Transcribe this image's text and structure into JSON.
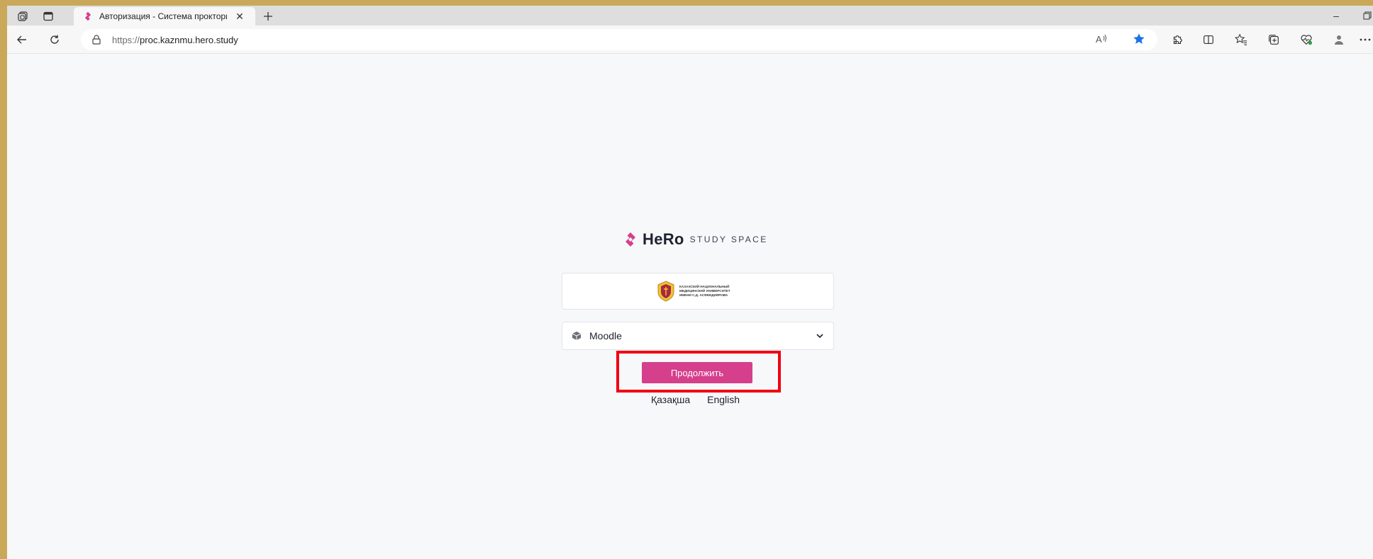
{
  "browser": {
    "tab_title": "Авторизация - Система прокторинга",
    "url_scheme": "https://",
    "url_host": "proc.kaznmu.hero.study"
  },
  "brand": {
    "name": "HeRo",
    "subtitle": "STUDY SPACE",
    "accent_color": "#d63f8c"
  },
  "university": {
    "name": "КАЗАХСКИЙ НАЦИОНАЛЬНЫЙ МЕДИЦИНСКИЙ УНИВЕРСИТЕТ ИМЕНИ С.Д. АСФЕНДИЯРОВА"
  },
  "login": {
    "selected_provider": "Moodle",
    "continue_label": "Продолжить"
  },
  "languages": [
    "Қазақша",
    "English"
  ],
  "icons": {
    "tab_actions": "tab-actions-icon",
    "vertical_tabs": "vertical-tabs-icon",
    "back": "back-arrow-icon",
    "refresh": "refresh-icon",
    "lock": "lock-icon",
    "read_aloud": "read-aloud-icon",
    "favorite": "star-icon",
    "extensions": "puzzle-icon",
    "split_screen": "split-screen-icon",
    "favorites": "favorites-icon",
    "collections": "collections-icon",
    "browser_essentials": "heart-pulse-icon",
    "profile": "profile-icon",
    "more": "more-icon",
    "moodle": "cube-icon",
    "chevron": "chevron-down-icon"
  }
}
